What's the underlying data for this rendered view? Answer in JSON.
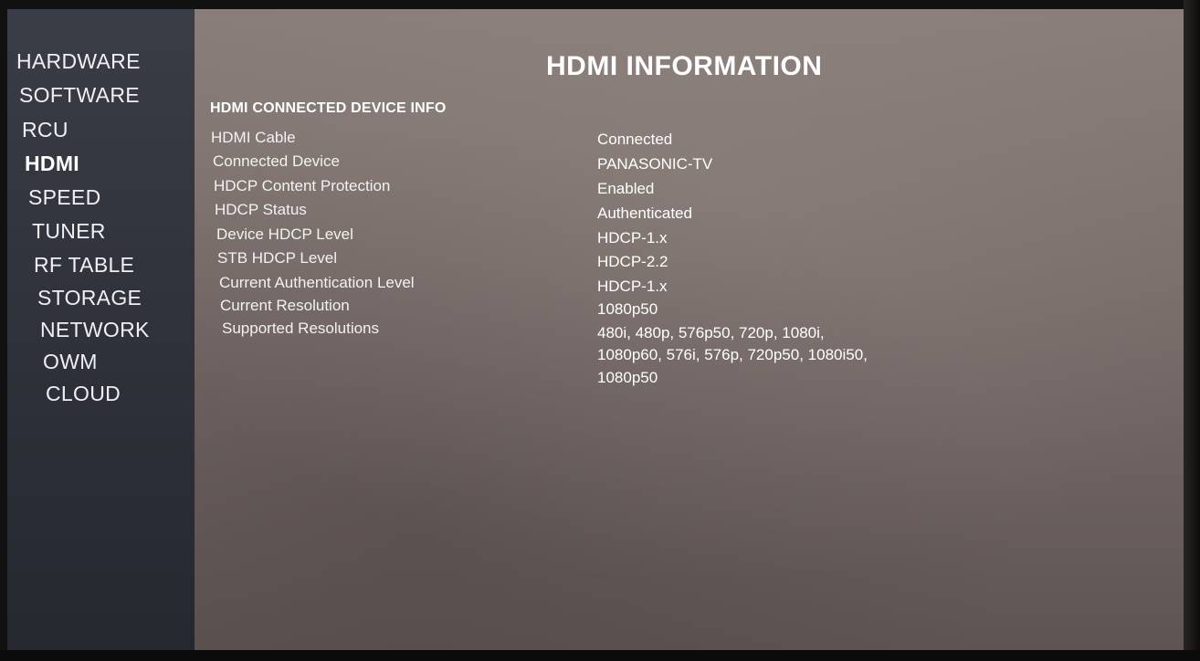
{
  "sidebar": {
    "items": [
      {
        "label": "HARDWARE",
        "active": false
      },
      {
        "label": "SOFTWARE",
        "active": false
      },
      {
        "label": "RCU",
        "active": false
      },
      {
        "label": "HDMI",
        "active": true
      },
      {
        "label": "SPEED",
        "active": false
      },
      {
        "label": "TUNER",
        "active": false
      },
      {
        "label": "RF TABLE",
        "active": false
      },
      {
        "label": "STORAGE",
        "active": false
      },
      {
        "label": "NETWORK",
        "active": false
      },
      {
        "label": "OWM",
        "active": false
      },
      {
        "label": "CLOUD",
        "active": false
      }
    ]
  },
  "main": {
    "title": "HDMI INFORMATION",
    "section_title": "HDMI CONNECTED DEVICE INFO",
    "rows": [
      {
        "label": "HDMI Cable",
        "value": "Connected"
      },
      {
        "label": "Connected Device",
        "value": "PANASONIC-TV"
      },
      {
        "label": "HDCP Content Protection",
        "value": "Enabled"
      },
      {
        "label": "HDCP Status",
        "value": "Authenticated"
      },
      {
        "label": "Device HDCP Level",
        "value": "HDCP-1.x"
      },
      {
        "label": "STB HDCP Level",
        "value": "HDCP-2.2"
      },
      {
        "label": "Current Authentication Level",
        "value": "HDCP-1.x"
      },
      {
        "label": "Current Resolution",
        "value": "1080p50"
      },
      {
        "label": "Supported Resolutions",
        "value_lines": [
          "480i, 480p, 576p50, 720p, 1080i,",
          "1080p60, 576i, 576p, 720p50, 1080i50,",
          "1080p50"
        ]
      }
    ]
  }
}
